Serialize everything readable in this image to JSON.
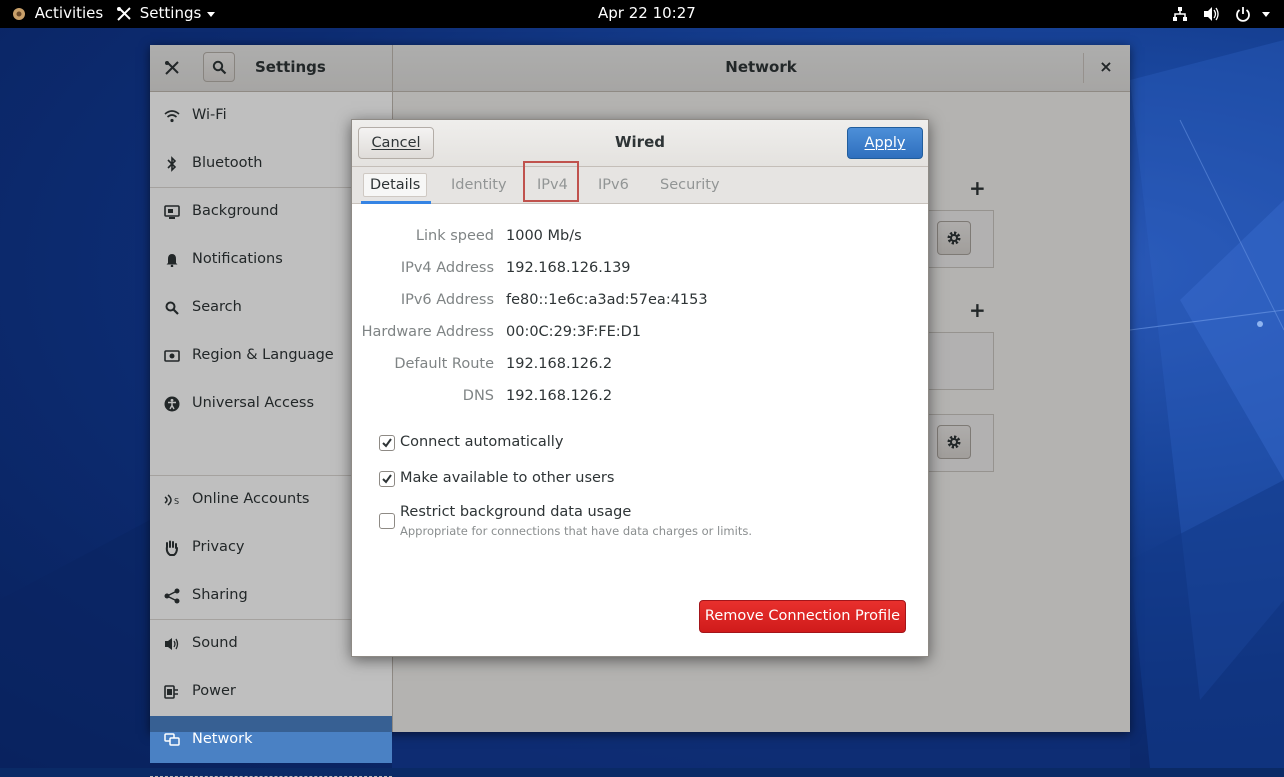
{
  "topbar": {
    "activities": "Activities",
    "app_menu": "Settings",
    "clock": "Apr 22  10:27"
  },
  "window": {
    "sidebar_title": "Settings",
    "panel_title": "Network",
    "close_glyph": "×"
  },
  "sidebar": {
    "items": [
      {
        "label": "Wi-Fi",
        "icon": "wifi-icon"
      },
      {
        "label": "Bluetooth",
        "icon": "bluetooth-icon"
      },
      {
        "label": "Background",
        "icon": "background-icon"
      },
      {
        "label": "Notifications",
        "icon": "bell-icon"
      },
      {
        "label": "Search",
        "icon": "search-icon"
      },
      {
        "label": "Region & Language",
        "icon": "region-icon"
      },
      {
        "label": "Universal Access",
        "icon": "universal-access-icon"
      },
      {
        "label": "Online Accounts",
        "icon": "online-accounts-icon"
      },
      {
        "label": "Privacy",
        "icon": "hand-icon"
      },
      {
        "label": "Sharing",
        "icon": "share-icon"
      },
      {
        "label": "Sound",
        "icon": "speaker-icon"
      },
      {
        "label": "Power",
        "icon": "power-plug-icon"
      },
      {
        "label": "Network",
        "icon": "network-icon",
        "active": true
      }
    ]
  },
  "dialog": {
    "cancel": "Cancel",
    "title": "Wired",
    "apply": "Apply",
    "tabs": [
      "Details",
      "Identity",
      "IPv4",
      "IPv6",
      "Security"
    ],
    "selected_tab": "Details",
    "details": [
      {
        "label": "Link speed",
        "value": "1000 Mb/s"
      },
      {
        "label": "IPv4 Address",
        "value": "192.168.126.139"
      },
      {
        "label": "IPv6 Address",
        "value": "fe80::1e6c:a3ad:57ea:4153"
      },
      {
        "label": "Hardware Address",
        "value": "00:0C:29:3F:FE:D1"
      },
      {
        "label": "Default Route",
        "value": "192.168.126.2"
      },
      {
        "label": "DNS",
        "value": "192.168.126.2"
      }
    ],
    "options": [
      {
        "label": "Connect automatically",
        "checked": true
      },
      {
        "label": "Make available to other users",
        "checked": true
      },
      {
        "label": "Restrict background data usage",
        "checked": false,
        "sublabel": "Appropriate for connections that have data charges or limits."
      }
    ],
    "remove": "Remove Connection Profile"
  },
  "colors": {
    "accent": "#3584e4",
    "sidebar_active": "#4a81c4",
    "apply_button": "#3f7fcc",
    "destructive": "#e01b24",
    "tab_highlight": "#c0524d"
  }
}
